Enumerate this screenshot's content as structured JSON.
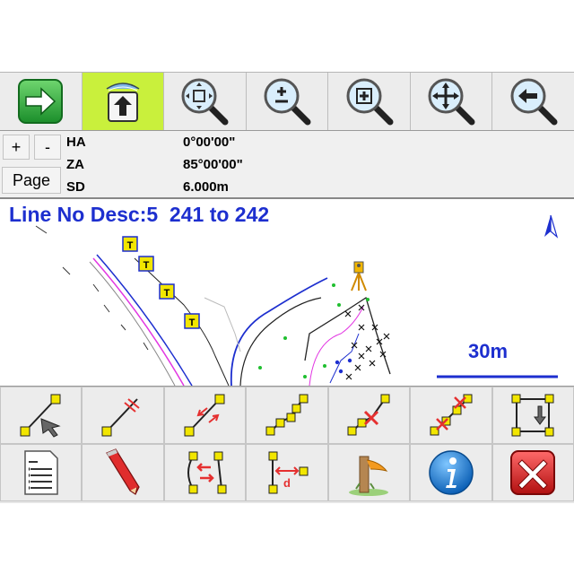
{
  "toolbar": {
    "buttons": [
      {
        "icon": "arrow-right-icon",
        "active": false
      },
      {
        "icon": "map-upload-icon",
        "active": true
      },
      {
        "icon": "zoom-extents-icon",
        "active": false
      },
      {
        "icon": "zoom-in-out-icon",
        "active": false
      },
      {
        "icon": "zoom-window-icon",
        "active": false
      },
      {
        "icon": "pan-icon",
        "active": false
      },
      {
        "icon": "zoom-previous-icon",
        "active": false
      }
    ]
  },
  "info": {
    "plus_label": "+",
    "minus_label": "-",
    "page_label": "Page",
    "rows": [
      {
        "key": "HA",
        "value": "0°00'00\""
      },
      {
        "key": "ZA",
        "value": "85°00'00\""
      },
      {
        "key": "SD",
        "value": "6.000m"
      }
    ]
  },
  "map": {
    "title": "Line No Desc:5  241 to 242",
    "scale_label": "30m",
    "north_icon": "north-arrow-icon",
    "instrument_icon": "total-station-icon",
    "colors": {
      "title": "#1d2fcf",
      "highlight": "#c9f03c",
      "marker": "#f2e600",
      "magenta": "#e236e2",
      "blue": "#1d2fcf",
      "green": "#1fbf2f"
    }
  },
  "bottom": {
    "row1": [
      "select-line-icon",
      "parallel-line-icon",
      "offset-line-icon",
      "polyline-icon",
      "delete-point-icon",
      "delete-line-icon",
      "move-box-icon"
    ],
    "row2": [
      "list-icon",
      "edit-pencil-icon",
      "curve-swap-icon",
      "distance-icon",
      "stakeout-icon",
      "info-icon",
      "close-icon"
    ]
  }
}
